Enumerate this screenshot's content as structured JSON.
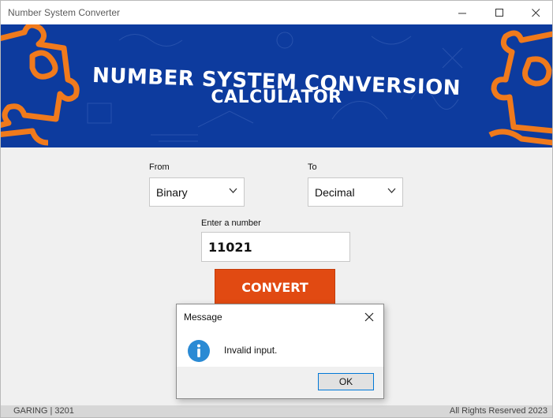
{
  "window": {
    "title": "Number System Converter"
  },
  "banner": {
    "line1": "NUMBER SYSTEM CONVERSION",
    "line2": "CALCULATOR"
  },
  "from": {
    "label": "From",
    "selected": "Binary"
  },
  "to": {
    "label": "To",
    "selected": "Decimal"
  },
  "input": {
    "label": "Enter a number",
    "value": "11021"
  },
  "convert": {
    "label": "CONVERT"
  },
  "statusbar": {
    "left": "GARING | 3201",
    "right": "All Rights Reserved 2023"
  },
  "dialog": {
    "title": "Message",
    "message": "Invalid input.",
    "ok_label": "OK"
  },
  "colors": {
    "banner_bg": "#0d3b9e",
    "puzzle": "#f07a1c",
    "convert_bg": "#e14a12",
    "info_icon": "#2a8ad4"
  },
  "icons": [
    "minimize-icon",
    "maximize-icon",
    "close-icon",
    "chevron-down-icon",
    "info-icon",
    "puzzle-piece-icon"
  ]
}
